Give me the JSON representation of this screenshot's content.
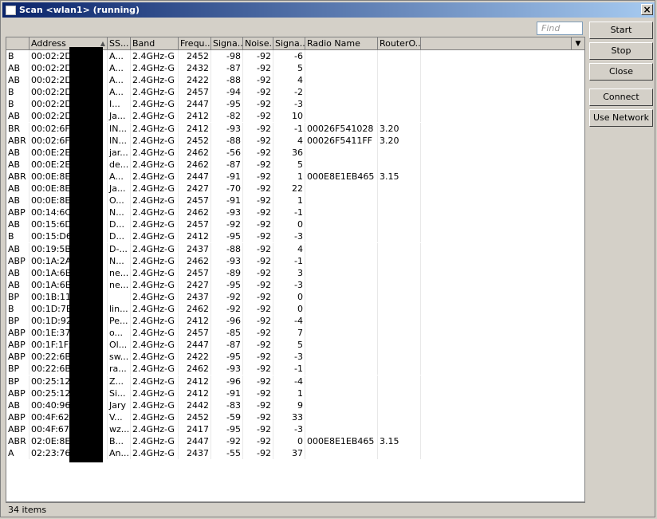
{
  "window": {
    "title": "Scan <wlan1> (running)"
  },
  "find": {
    "placeholder": "Find"
  },
  "columns": [
    "",
    "Address",
    "SS...",
    "Band",
    "Frequ...",
    "Signa...",
    "Noise...",
    "Signa...",
    "Radio Name",
    "RouterO..."
  ],
  "rows": [
    [
      "B",
      "00:02:2D:",
      "A...",
      "2.4GHz-G",
      "2452",
      "-98",
      "-92",
      "-6",
      "",
      ""
    ],
    [
      "AB",
      "00:02:2D:",
      "A...",
      "2.4GHz-G",
      "2432",
      "-87",
      "-92",
      "5",
      "",
      ""
    ],
    [
      "AB",
      "00:02:2D:",
      "A...",
      "2.4GHz-G",
      "2422",
      "-88",
      "-92",
      "4",
      "",
      ""
    ],
    [
      "B",
      "00:02:2D:",
      "A...",
      "2.4GHz-G",
      "2457",
      "-94",
      "-92",
      "-2",
      "",
      ""
    ],
    [
      "B",
      "00:02:2D:",
      "I...",
      "2.4GHz-G",
      "2447",
      "-95",
      "-92",
      "-3",
      "",
      ""
    ],
    [
      "AB",
      "00:02:2D:",
      "Ja...",
      "2.4GHz-G",
      "2412",
      "-82",
      "-92",
      "10",
      "",
      ""
    ],
    [
      "BR",
      "00:02:6F:",
      "IN...",
      "2.4GHz-G",
      "2412",
      "-93",
      "-92",
      "-1",
      "00026F541028",
      "3.20"
    ],
    [
      "ABR",
      "00:02:6F:",
      "IN...",
      "2.4GHz-G",
      "2452",
      "-88",
      "-92",
      "4",
      "00026F5411FF",
      "3.20"
    ],
    [
      "AB",
      "00:0E:2E:",
      "jar...",
      "2.4GHz-G",
      "2462",
      "-56",
      "-92",
      "36",
      "",
      ""
    ],
    [
      "AB",
      "00:0E:2E:",
      "de...",
      "2.4GHz-G",
      "2462",
      "-87",
      "-92",
      "5",
      "",
      ""
    ],
    [
      "ABR",
      "00:0E:8E:",
      "A...",
      "2.4GHz-G",
      "2447",
      "-91",
      "-92",
      "1",
      "000E8E1EB465",
      "3.15"
    ],
    [
      "AB",
      "00:0E:8E:",
      "Ja...",
      "2.4GHz-G",
      "2427",
      "-70",
      "-92",
      "22",
      "",
      ""
    ],
    [
      "AB",
      "00:0E:8E:",
      "O...",
      "2.4GHz-G",
      "2457",
      "-91",
      "-92",
      "1",
      "",
      ""
    ],
    [
      "ABP",
      "00:14:6C:",
      "N...",
      "2.4GHz-G",
      "2462",
      "-93",
      "-92",
      "-1",
      "",
      ""
    ],
    [
      "AB",
      "00:15:6D:",
      "D...",
      "2.4GHz-G",
      "2457",
      "-92",
      "-92",
      "0",
      "",
      ""
    ],
    [
      "B",
      "00:15:D6:",
      "D...",
      "2.4GHz-G",
      "2412",
      "-95",
      "-92",
      "-3",
      "",
      ""
    ],
    [
      "AB",
      "00:19:5B:",
      "D-...",
      "2.4GHz-G",
      "2437",
      "-88",
      "-92",
      "4",
      "",
      ""
    ],
    [
      "ABP",
      "00:1A:2A:",
      "N...",
      "2.4GHz-G",
      "2462",
      "-93",
      "-92",
      "-1",
      "",
      ""
    ],
    [
      "AB",
      "00:1A:6B:",
      "ne...",
      "2.4GHz-G",
      "2457",
      "-89",
      "-92",
      "3",
      "",
      ""
    ],
    [
      "AB",
      "00:1A:6B:",
      "ne...",
      "2.4GHz-G",
      "2427",
      "-95",
      "-92",
      "-3",
      "",
      ""
    ],
    [
      "BP",
      "00:1B:11:",
      "",
      "2.4GHz-G",
      "2437",
      "-92",
      "-92",
      "0",
      "",
      ""
    ],
    [
      "B",
      "00:1D:7E:",
      "lin...",
      "2.4GHz-G",
      "2462",
      "-92",
      "-92",
      "0",
      "",
      ""
    ],
    [
      "BP",
      "00:1D:92:",
      "Pe...",
      "2.4GHz-G",
      "2412",
      "-96",
      "-92",
      "-4",
      "",
      ""
    ],
    [
      "ABP",
      "00:1E:37:",
      "o...",
      "2.4GHz-G",
      "2457",
      "-85",
      "-92",
      "7",
      "",
      ""
    ],
    [
      "ABP",
      "00:1F:1F:",
      "Ol...",
      "2.4GHz-G",
      "2447",
      "-87",
      "-92",
      "5",
      "",
      ""
    ],
    [
      "ABP",
      "00:22:6B:",
      "sw...",
      "2.4GHz-G",
      "2422",
      "-95",
      "-92",
      "-3",
      "",
      ""
    ],
    [
      "BP",
      "00:22:6B:",
      "ra...",
      "2.4GHz-G",
      "2462",
      "-93",
      "-92",
      "-1",
      "",
      ""
    ],
    [
      "BP",
      "00:25:12:",
      "Z...",
      "2.4GHz-G",
      "2412",
      "-96",
      "-92",
      "-4",
      "",
      ""
    ],
    [
      "ABP",
      "00:25:12:",
      "Si...",
      "2.4GHz-G",
      "2412",
      "-91",
      "-92",
      "1",
      "",
      ""
    ],
    [
      "AB",
      "00:40:96:",
      "Jary",
      "2.4GHz-G",
      "2442",
      "-83",
      "-92",
      "9",
      "",
      ""
    ],
    [
      "ABP",
      "00:4F:62:",
      "V...",
      "2.4GHz-G",
      "2452",
      "-59",
      "-92",
      "33",
      "",
      ""
    ],
    [
      "ABP",
      "00:4F:67:",
      "wz...",
      "2.4GHz-G",
      "2417",
      "-95",
      "-92",
      "-3",
      "",
      ""
    ],
    [
      "ABR",
      "02:0E:8E:",
      "B...",
      "2.4GHz-G",
      "2447",
      "-92",
      "-92",
      "0",
      "000E8E1EB465",
      "3.15"
    ],
    [
      "A",
      "02:23:76:",
      "An...",
      "2.4GHz-G",
      "2437",
      "-55",
      "-92",
      "37",
      "",
      ""
    ]
  ],
  "status": {
    "items": "34 items"
  },
  "buttons": {
    "start": "Start",
    "stop": "Stop",
    "close": "Close",
    "connect": "Connect",
    "use_network": "Use Network"
  }
}
